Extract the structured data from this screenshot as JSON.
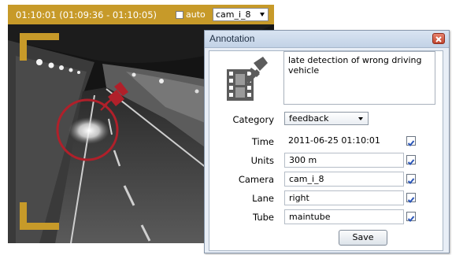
{
  "video": {
    "timecode": "01:10:01 (01:09:36 - 01:10:05)",
    "auto_label": "auto",
    "auto_checked": false,
    "camera_selected": "cam_i_8"
  },
  "dialog": {
    "title": "Annotation",
    "icon": "film-pin-icon",
    "description": "late detection of wrong driving vehicle",
    "category": {
      "label": "Category",
      "value": "feedback"
    },
    "fields": [
      {
        "label": "Time",
        "value": "2011-06-25 01:10:01",
        "editable": false,
        "checked": true
      },
      {
        "label": "Units",
        "value": "300 m",
        "editable": true,
        "checked": true
      },
      {
        "label": "Camera",
        "value": "cam_i_8",
        "editable": true,
        "checked": true
      },
      {
        "label": "Lane",
        "value": "right",
        "editable": true,
        "checked": true
      },
      {
        "label": "Tube",
        "value": "maintube",
        "editable": true,
        "checked": true
      }
    ],
    "save_label": "Save"
  },
  "colors": {
    "accent_gold": "#c79a29",
    "marker_red": "#b0202a",
    "dialog_bg": "#e8eef6",
    "checkbox_blue": "#2b56b8"
  }
}
